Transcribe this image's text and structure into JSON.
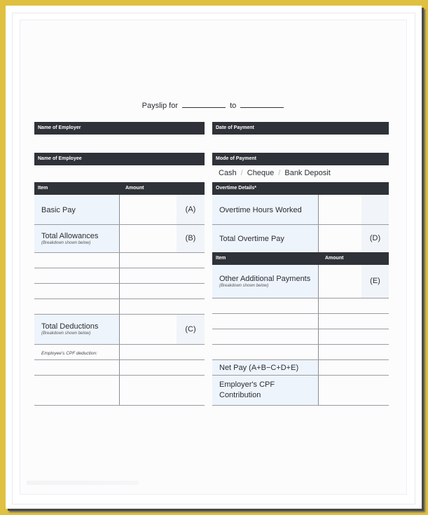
{
  "document": {
    "title_prefix": "Payslip for",
    "title_mid": "to"
  },
  "left": {
    "employer_label": "Name of Employer",
    "employee_label": "Name of Employee",
    "table_header": {
      "item": "Item",
      "amount": "Amount"
    },
    "rows": [
      {
        "label": "Basic Pay",
        "sub": "",
        "code": "(A)"
      },
      {
        "label": "Total Allowances",
        "sub": "(Breakdown shown below)",
        "code": "(B)"
      },
      {
        "label": "Total Deductions",
        "sub": "(Breakdown shown below)",
        "code": "(C)"
      }
    ],
    "cpf_deduction_label": "Employee's CPF deduction:"
  },
  "right": {
    "date_label": "Date of Payment",
    "mode_label": "Mode of Payment",
    "modes": [
      "Cash",
      "Cheque",
      "Bank Deposit"
    ],
    "mode_separator": "/",
    "overtime_header": "Overtime Details*",
    "overtime_rows": [
      {
        "label": "Overtime Hours Worked",
        "code": ""
      },
      {
        "label": "Total Overtime Pay",
        "code": "(D)"
      }
    ],
    "table_header": {
      "item": "Item",
      "amount": "Amount"
    },
    "other_payments": {
      "label": "Other Additional Payments",
      "sub": "(Breakdown shown below)",
      "code": "(E)"
    },
    "net_pay_label": "Net Pay (A+B−C+D+E)",
    "employer_cpf_label_line1": "Employer's CPF",
    "employer_cpf_label_line2": "Contribution"
  }
}
